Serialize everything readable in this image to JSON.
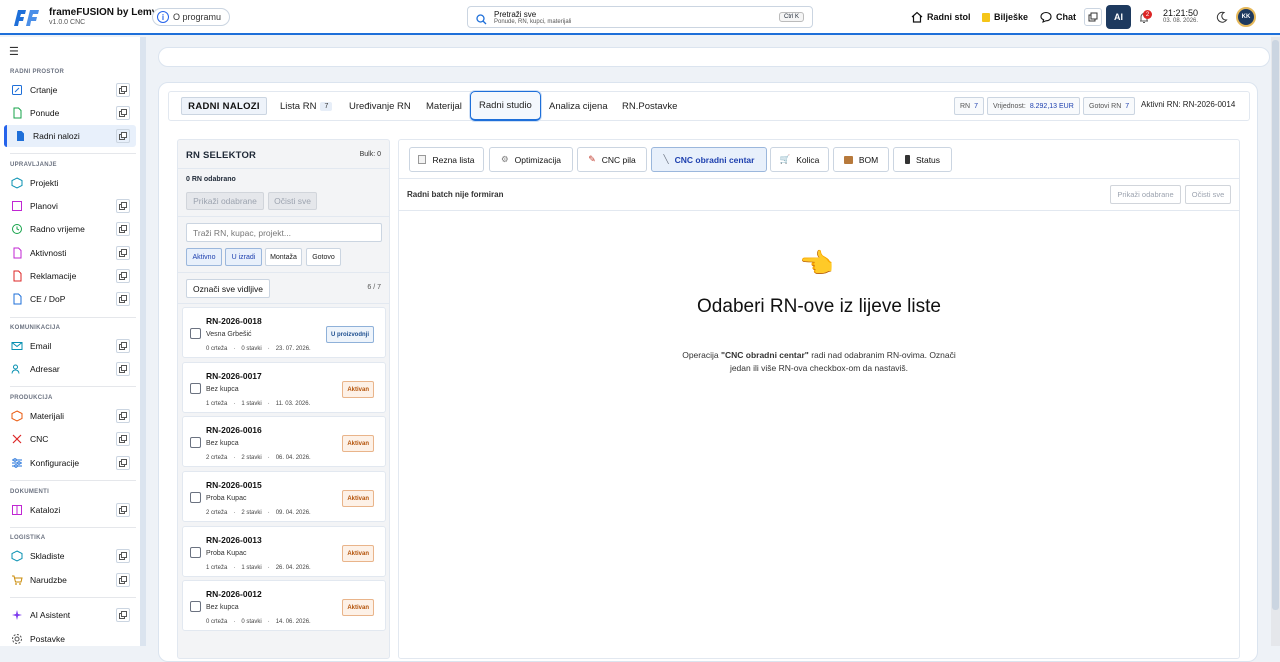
{
  "app": {
    "title": "frameFUSION by Lemy",
    "version": "v1.0.0 CNC",
    "about": "O programu"
  },
  "search": {
    "label": "Pretraži sve",
    "placeholder": "Ponude, RN, kupci, materijali",
    "shortcut": "Ctrl K"
  },
  "topnav": {
    "desk": "Radni stol",
    "notes": "Bilješke",
    "chat": "Chat",
    "ai": "AI",
    "notif_count": "2",
    "time": "21:21:50",
    "date": "03. 08. 2026.",
    "avatar": "KK"
  },
  "sidebar": {
    "sections": [
      "RADNI PROSTOR",
      "UPRAVLJANJE",
      "KOMUNIKACIJA",
      "PRODUKCIJA",
      "DOKUMENTI",
      "LOGISTIKA"
    ],
    "items": [
      "Crtanje",
      "Ponude",
      "Radni nalozi",
      "Projekti",
      "Planovi",
      "Radno vrijeme",
      "Aktivnosti",
      "Reklamacije",
      "CE / DoP",
      "Email",
      "Adresar",
      "Materijali",
      "CNC",
      "Konfiguracije",
      "Katalozi",
      "Skladiste",
      "Narudzbe",
      "AI Asistent",
      "Postavke"
    ]
  },
  "module": {
    "title": "RADNI NALOZI",
    "tabs": [
      {
        "label": "Lista RN",
        "count": "7"
      },
      {
        "label": "Uređivanje RN"
      },
      {
        "label": "Materijal"
      },
      {
        "label": "Radni studio"
      },
      {
        "label": "Analiza cijena"
      },
      {
        "label": "RN.Postavke"
      }
    ],
    "stats": {
      "rn_label": "RN",
      "rn_value": "7",
      "value_label": "Vrijednost:",
      "value_value": "8.292,13 EUR",
      "done_label": "Gotovi RN",
      "done_value": "7"
    },
    "active_rn": "Aktivni RN: RN-2026-0014"
  },
  "selector": {
    "title": "RN SELEKTOR",
    "bulk": "Bulk: 0",
    "selected": "0 RN odabrano",
    "show_btn": "Prikaži odabrane",
    "clear_btn": "Očisti sve",
    "search_placeholder": "Traži RN, kupac, projekt...",
    "filters": [
      "Aktivno",
      "U izradi",
      "Montaža",
      "Gotovo"
    ],
    "mark_all": "Označi sve vidljive",
    "count": "6 / 7",
    "cards": [
      {
        "num": "RN-2026-0018",
        "cust": "Vesna Grbešić",
        "drawings": "0 crteža",
        "items": "0 stavki",
        "date": "23. 07. 2026.",
        "status": "U proizvodnji"
      },
      {
        "num": "RN-2026-0017",
        "cust": "Bez kupca",
        "drawings": "1 crteža",
        "items": "1 stavki",
        "date": "11. 03. 2026.",
        "status": "Aktivan"
      },
      {
        "num": "RN-2026-0016",
        "cust": "Bez kupca",
        "drawings": "2 crteža",
        "items": "2 stavki",
        "date": "06. 04. 2026.",
        "status": "Aktivan"
      },
      {
        "num": "RN-2026-0015",
        "cust": "Proba Kupac",
        "drawings": "2 crteža",
        "items": "2 stavki",
        "date": "09. 04. 2026.",
        "status": "Aktivan"
      },
      {
        "num": "RN-2026-0013",
        "cust": "Proba Kupac",
        "drawings": "1 crteža",
        "items": "1 stavki",
        "date": "26. 04. 2026.",
        "status": "Aktivan"
      },
      {
        "num": "RN-2026-0012",
        "cust": "Bez kupca",
        "drawings": "0 crteža",
        "items": "0 stavki",
        "date": "14. 06. 2026.",
        "status": "Aktivan"
      }
    ]
  },
  "workspace": {
    "ops": [
      "Rezna lista",
      "Optimizacija",
      "CNC pila",
      "CNC obradni centar",
      "Kolica",
      "BOM",
      "Status"
    ],
    "batch": "Radni batch nije formiran",
    "show_btn": "Prikaži odabrane",
    "clear_btn": "Očisti sve",
    "empty_title": "Odaberi RN-ove iz lijeve liste",
    "desc_pre": "Operacija ",
    "desc_op": "\"CNC obradni centar\"",
    "desc_post": " radi nad odabranim RN-ovima. Označi jedan ili više RN-ova checkbox-om da nastaviš."
  }
}
